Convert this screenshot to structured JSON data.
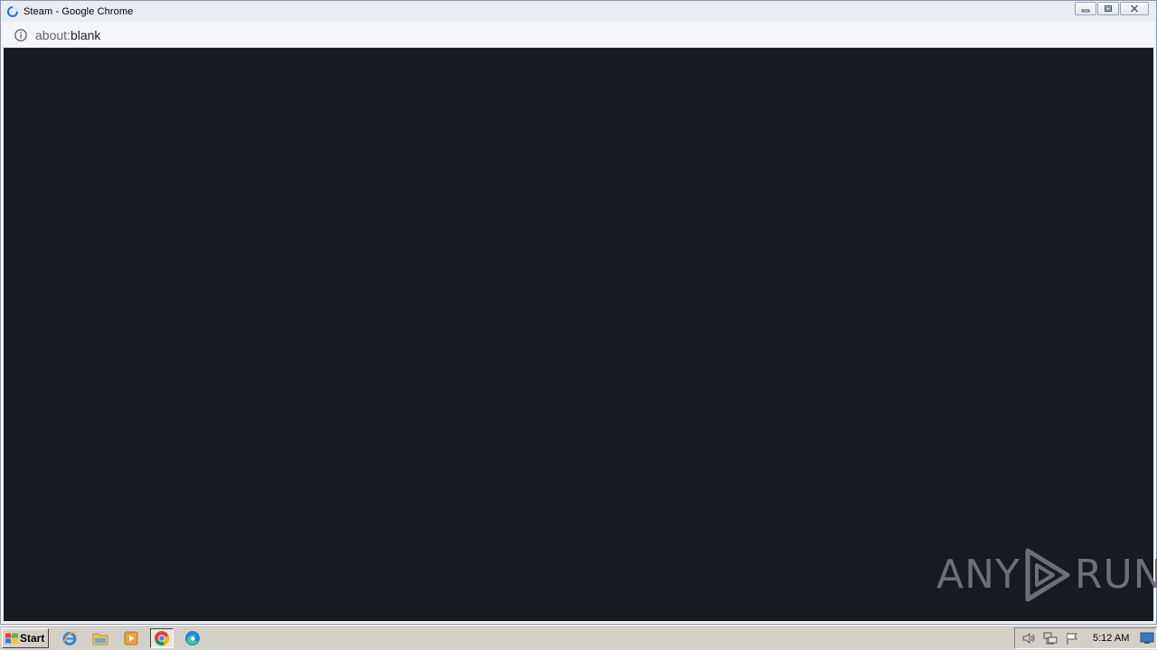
{
  "window": {
    "title": "Steam - Google Chrome"
  },
  "addressbar": {
    "scheme": "about:",
    "host": "blank"
  },
  "watermark": {
    "left": "ANY",
    "right": "RUN"
  },
  "taskbar": {
    "start_label": "Start",
    "quick_launch": [
      "internet-explorer-icon",
      "explorer-folder-icon",
      "media-player-icon",
      "chrome-icon",
      "edge-icon"
    ],
    "clock": "5:12 AM"
  },
  "colors": {
    "content_bg": "#171a21",
    "taskbar_bg": "#d4d0c8",
    "titlebar_bg": "#e9ecf1"
  }
}
